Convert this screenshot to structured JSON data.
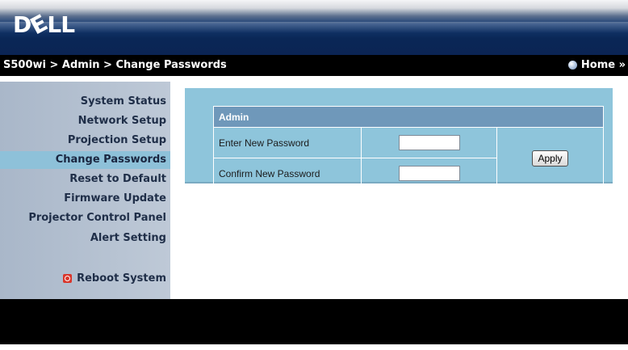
{
  "header": {
    "logo_text": "DELL",
    "logo_before": "D",
    "logo_e": "E",
    "logo_after": "LL"
  },
  "breadcrumb": "S500wi > Admin > Change Passwords",
  "home_link": "Home »",
  "sidebar": {
    "items": [
      {
        "label": "System Status"
      },
      {
        "label": "Network Setup"
      },
      {
        "label": "Projection Setup"
      },
      {
        "label": "Change Passwords",
        "active": true
      },
      {
        "label": "Reset to Default"
      },
      {
        "label": "Firmware Update"
      },
      {
        "label": "Projector Control Panel"
      },
      {
        "label": "Alert Setting"
      }
    ],
    "reboot_label": "Reboot System"
  },
  "admin_table": {
    "header": "Admin",
    "rows": [
      {
        "label": "Enter New Password",
        "value": ""
      },
      {
        "label": "Confirm New Password",
        "value": ""
      }
    ],
    "apply_label": "Apply"
  },
  "colors": {
    "sidebar_bg": "#b7c3d2",
    "active_item": "#8ec1d9",
    "panel_bg": "#8ec5db",
    "table_header": "#6f98ba",
    "navbar_bg": "#000000"
  }
}
